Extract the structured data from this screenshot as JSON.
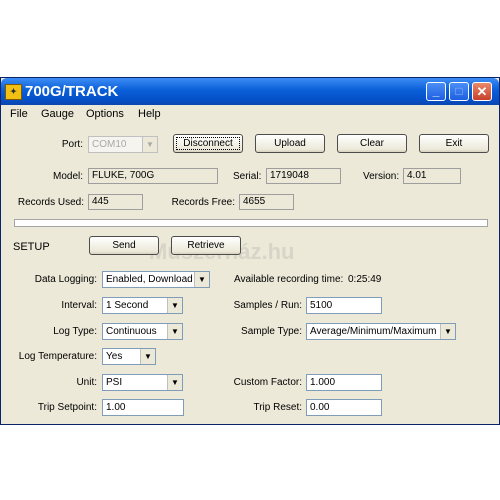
{
  "window": {
    "title": "700G/TRACK",
    "icon": "fluke-app-icon",
    "accent": "#0a5fd8"
  },
  "titlebar_buttons": {
    "minimize": "minimize-icon",
    "maximize": "maximize-icon",
    "close": "close-icon",
    "close_glyph": "✕"
  },
  "menu": {
    "items": [
      "File",
      "Gauge",
      "Options",
      "Help"
    ]
  },
  "port": {
    "label": "Port:",
    "value": "COM10"
  },
  "buttons": {
    "disconnect": "Disconnect",
    "upload": "Upload",
    "clear": "Clear",
    "exit": "Exit",
    "send": "Send",
    "retrieve": "Retrieve"
  },
  "info": {
    "model_label": "Model:",
    "model": "FLUKE, 700G",
    "serial_label": "Serial:",
    "serial": "1719048",
    "version_label": "Version:",
    "version": "4.01",
    "records_used_label": "Records Used:",
    "records_used": "445",
    "records_free_label": "Records Free:",
    "records_free": "4655"
  },
  "progress": {
    "value": 0
  },
  "watermark": "Műszerház.hu",
  "setup": {
    "heading": "SETUP",
    "data_logging_label": "Data Logging:",
    "data_logging": "Enabled, Download",
    "recording_time_label": "Available recording time:",
    "recording_time": "0:25:49",
    "interval_label": "Interval:",
    "interval": "1 Second",
    "samples_label": "Samples / Run:",
    "samples": "5100",
    "log_type_label": "Log Type:",
    "log_type": "Continuous",
    "sample_type_label": "Sample Type:",
    "sample_type": "Average/Minimum/Maximum",
    "log_temp_label": "Log Temperature:",
    "log_temp": "Yes",
    "unit_label": "Unit:",
    "unit": "PSI",
    "custom_factor_label": "Custom Factor:",
    "custom_factor": "1.000",
    "trip_setpoint_label": "Trip Setpoint:",
    "trip_setpoint": "1.00",
    "trip_reset_label": "Trip Reset:",
    "trip_reset": "0.00"
  }
}
